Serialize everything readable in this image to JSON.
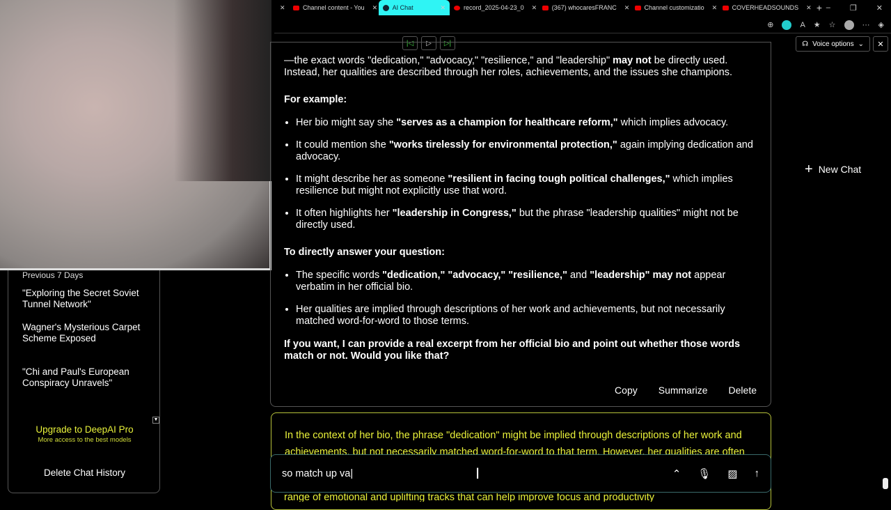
{
  "tabs": [
    {
      "label": "Channel content - You"
    },
    {
      "label": "AI Chat",
      "active": true
    },
    {
      "label": "record_2025-04-23_0"
    },
    {
      "label": "(367) whocaresFRANC"
    },
    {
      "label": "Channel customizatio"
    },
    {
      "label": "COVERHEADSOUNDS"
    }
  ],
  "toolbar": {
    "voice_options": "Voice options"
  },
  "sidebar": {
    "section": "Previous 7 Days",
    "items": [
      "\"Exploring the Secret Soviet Tunnel Network\"",
      "Wagner's Mysterious Carpet Scheme Exposed",
      "\"Chi and Paul's European Conspiracy Unravels\""
    ],
    "upgrade": "Upgrade to DeepAI Pro",
    "upgrade_sub": "More access to the best models",
    "delete_history": "Delete Chat History"
  },
  "new_chat": "New Chat",
  "message": {
    "intro_a": "—the exact words \"dedication,\" \"advocacy,\" \"resilience,\" and \"leadership\" ",
    "intro_b": "may not",
    "intro_c": " be directly used. Instead, her qualities are described through her roles, achievements, and the issues she champions.",
    "example_heading": "For example:",
    "examples": [
      {
        "a": "Her bio might say she ",
        "b": "\"serves as a champion for healthcare reform,\"",
        "c": " which implies advocacy."
      },
      {
        "a": "It could mention she ",
        "b": "\"works tirelessly for environmental protection,\"",
        "c": " again implying dedication and advocacy."
      },
      {
        "a": "It might describe her as someone ",
        "b": "\"resilient in facing tough political challenges,\"",
        "c": " which implies resilience but might not explicitly use that word."
      },
      {
        "a": "It often highlights her ",
        "b": "\"leadership in Congress,\"",
        "c": " but the phrase \"leadership qualities\" might not be directly used."
      }
    ],
    "answer_heading": "To directly answer your question:",
    "answers": [
      {
        "a": "The specific words ",
        "b": "\"dedication,\" \"advocacy,\" \"resilience,\"",
        "c": " and ",
        "d": "\"leadership\" may not",
        "e": " appear verbatim in her official bio."
      },
      {
        "a": "Her qualities are implied through descriptions of her work and achievements, but not necessarily matched word-for-word to those terms."
      }
    ],
    "closing": "If you want, I can provide a real excerpt from her official bio and point out whether those words match or not. Would you like that?",
    "copy": "Copy",
    "summarize": "Summarize",
    "delete": "Delete"
  },
  "message2": {
    "text": "In the context of her bio, the phrase \"dedication\" might be implied through descriptions of her work and achievements, but not necessarily matched word-for-word to that term. However, her qualities are often",
    "tail": "range of emotional and uplifting tracks that can help improve focus and productivity"
  },
  "input": {
    "value": "so match up va"
  }
}
